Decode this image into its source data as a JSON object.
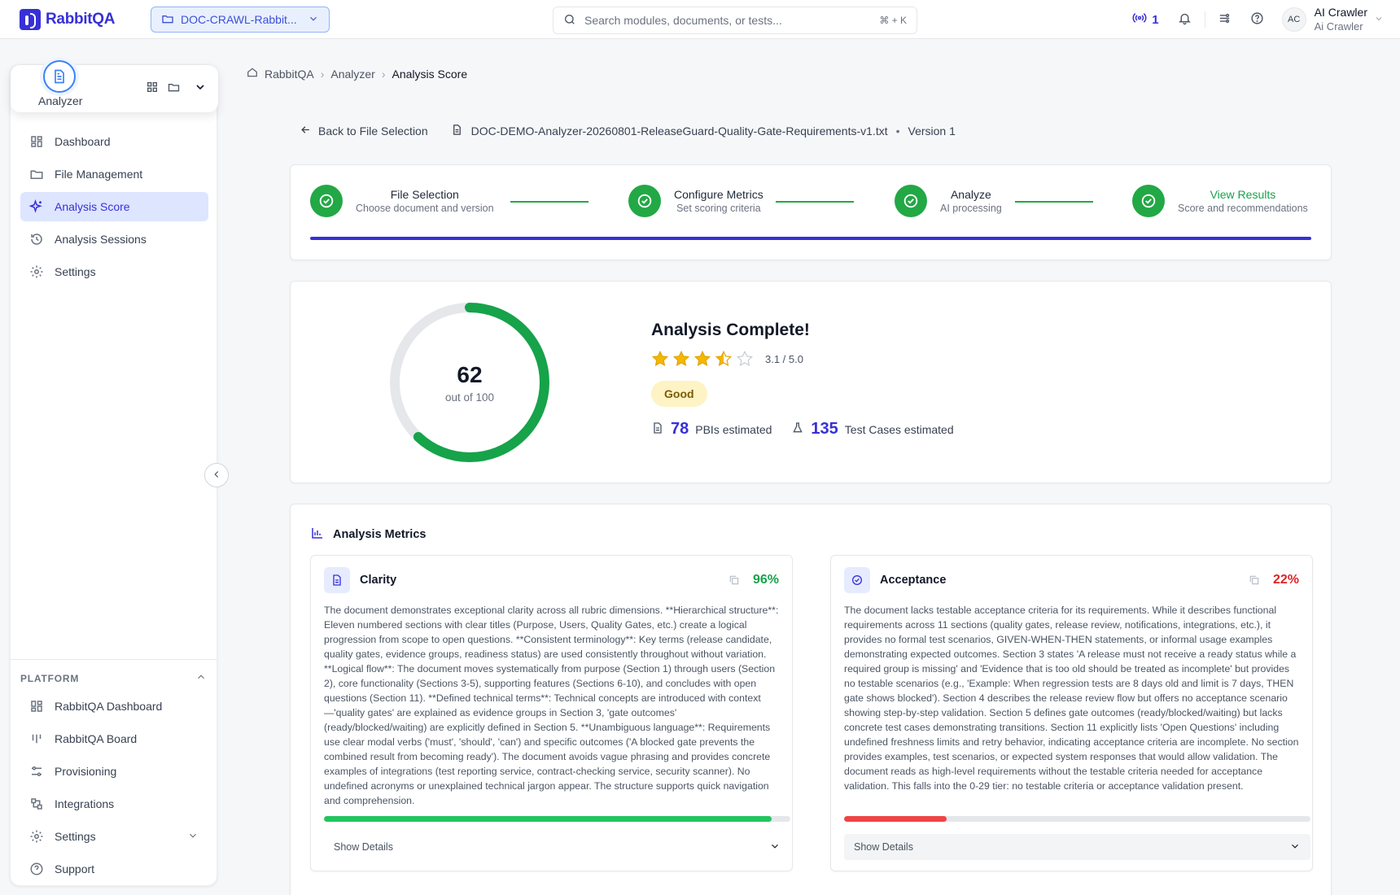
{
  "app": {
    "name": "RabbitQA"
  },
  "topbar": {
    "project": "DOC-CRAWL-Rabbit...",
    "search_placeholder": "Search modules, documents, or tests...",
    "shortcut": "⌘ + K",
    "live_count": "1",
    "user_name": "AI Crawler",
    "user_role": "Ai Crawler",
    "avatar_initials": "AC"
  },
  "sidebar": {
    "module_label": "Analyzer",
    "items": [
      {
        "label": "Dashboard",
        "icon": "dashboard-icon"
      },
      {
        "label": "File Management",
        "icon": "folder-icon"
      },
      {
        "label": "Analysis Score",
        "icon": "sparkle-icon",
        "active": true
      },
      {
        "label": "Analysis Sessions",
        "icon": "history-icon"
      },
      {
        "label": "Settings",
        "icon": "gear-icon"
      }
    ],
    "platform_heading": "PLATFORM",
    "platform_items": [
      {
        "label": "RabbitQA Dashboard",
        "icon": "dashboard-icon"
      },
      {
        "label": "RabbitQA Board",
        "icon": "board-icon"
      },
      {
        "label": "Provisioning",
        "icon": "sliders-icon"
      },
      {
        "label": "Integrations",
        "icon": "integrations-icon"
      },
      {
        "label": "Settings",
        "icon": "gear-icon"
      },
      {
        "label": "Support",
        "icon": "help-icon"
      }
    ]
  },
  "breadcrumb": [
    "RabbitQA",
    "Analyzer",
    "Analysis Score"
  ],
  "file": {
    "back_label": "Back to File Selection",
    "name": "DOC-DEMO-Analyzer-20260801-ReleaseGuard-Quality-Gate-Requirements-v1.txt",
    "separator": "•",
    "version": "Version 1"
  },
  "steps": [
    {
      "title": "File Selection",
      "subtitle": "Choose document and version"
    },
    {
      "title": "Configure Metrics",
      "subtitle": "Set scoring criteria"
    },
    {
      "title": "Analyze",
      "subtitle": "AI processing"
    },
    {
      "title": "View Results",
      "subtitle": "Score and recommendations"
    }
  ],
  "score": {
    "value": 62,
    "max": 100,
    "out_of_label": "out of 100",
    "title": "Analysis Complete!",
    "stars": 3.1,
    "rating_text": "3.1 / 5.0",
    "grade": "Good",
    "pbis": "78",
    "pbis_label": "PBIs estimated",
    "tests": "135",
    "tests_label": "Test Cases estimated"
  },
  "metrics": {
    "title": "Analysis Metrics",
    "details_label": "Show Details",
    "items": [
      {
        "name": "Clarity",
        "percent": 96,
        "percent_text": "96%",
        "color": "#22c55e",
        "text_color": "#16a34a",
        "description": "The document demonstrates exceptional clarity across all rubric dimensions. **Hierarchical structure**: Eleven numbered sections with clear titles (Purpose, Users, Quality Gates, etc.) create a logical progression from scope to open questions. **Consistent terminology**: Key terms (release candidate, quality gates, evidence groups, readiness status) are used consistently throughout without variation. **Logical flow**: The document moves systematically from purpose (Section 1) through users (Section 2), core functionality (Sections 3-5), supporting features (Sections 6-10), and concludes with open questions (Section 11). **Defined technical terms**: Technical concepts are introduced with context—'quality gates' are explained as evidence groups in Section 3, 'gate outcomes' (ready/blocked/waiting) are explicitly defined in Section 5. **Unambiguous language**: Requirements use clear modal verbs ('must', 'should', 'can') and specific outcomes ('A blocked gate prevents the combined result from becoming ready'). The document avoids vague phrasing and provides concrete examples of integrations (test reporting service, contract-checking service, security scanner). No undefined acronyms or unexplained technical jargon appear. The structure supports quick navigation and comprehension."
      },
      {
        "name": "Acceptance",
        "percent": 22,
        "percent_text": "22%",
        "color": "#ef4444",
        "text_color": "#dc2626",
        "description": "The document lacks testable acceptance criteria for its requirements. While it describes functional requirements across 11 sections (quality gates, release review, notifications, integrations, etc.), it provides no formal test scenarios, GIVEN-WHEN-THEN statements, or informal usage examples demonstrating expected outcomes. Section 3 states 'A release must not receive a ready status while a required group is missing' and 'Evidence that is too old should be treated as incomplete' but provides no testable scenarios (e.g., 'Example: When regression tests are 8 days old and limit is 7 days, THEN gate shows blocked'). Section 4 describes the release review flow but offers no acceptance scenario showing step-by-step validation. Section 5 defines gate outcomes (ready/blocked/waiting) but lacks concrete test cases demonstrating transitions. Section 11 explicitly lists 'Open Questions' including undefined freshness limits and retry behavior, indicating acceptance criteria are incomplete. No section provides examples, test scenarios, or expected system responses that would allow validation. The document reads as high-level requirements without the testable criteria needed for acceptance validation. This falls into the 0-29 tier: no testable criteria or acceptance validation present."
      }
    ]
  },
  "colors": {
    "brand": "#3730d6",
    "success": "#22a845",
    "gauge_track": "#e5e7eb",
    "star": "#f5b800"
  }
}
